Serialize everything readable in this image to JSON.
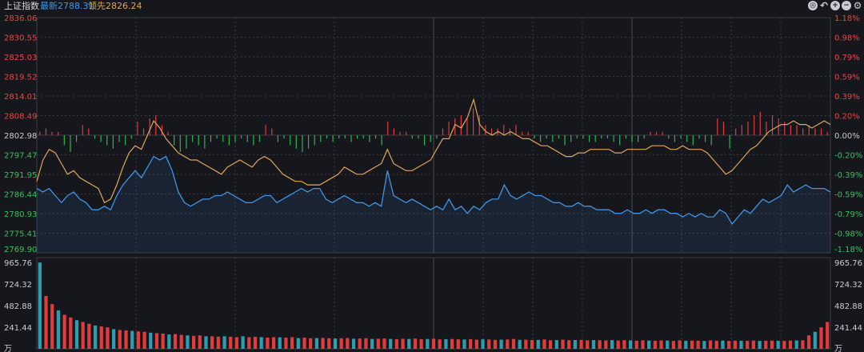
{
  "header": {
    "title": "上证指数",
    "latest": "最新2788.31",
    "lead": "领先2826.24"
  },
  "tools": [
    {
      "name": "target-icon",
      "glyph": "◎"
    },
    {
      "name": "undo-icon",
      "glyph": "↶"
    },
    {
      "name": "zoom-in-icon",
      "glyph": "+"
    },
    {
      "name": "zoom-out-icon",
      "glyph": "−"
    },
    {
      "name": "settings-icon",
      "glyph": "⚙"
    }
  ],
  "colors": {
    "up": "#e23b3b",
    "down": "#2eb44c",
    "price_line": "#3f95e8",
    "lead_line": "#e0a45a",
    "volume_teal": "#2a9fb0",
    "grid": "#3a3c44"
  },
  "chart_data": [
    {
      "type": "line",
      "y_left_ticks": [
        "2836.06",
        "2830.55",
        "2825.03",
        "2819.52",
        "2814.01",
        "2808.49",
        "2802.98",
        "2797.47",
        "2791.95",
        "2786.44",
        "2780.93",
        "2775.41",
        "2769.90"
      ],
      "y_right_ticks": [
        "1.18%",
        "0.98%",
        "0.79%",
        "0.59%",
        "0.39%",
        "0.20%",
        "0.00%",
        "-0.20%",
        "-0.39%",
        "-0.59%",
        "-0.79%",
        "-0.98%",
        "-1.18%"
      ],
      "ylim": [
        2769.9,
        2836.06
      ],
      "base": 2802.98,
      "series": [
        {
          "key": "price",
          "values": [
            2788,
            2787,
            2788,
            2786,
            2784,
            2786,
            2787,
            2785,
            2784,
            2782,
            2782,
            2783,
            2782,
            2786,
            2789,
            2791,
            2793,
            2791,
            2794,
            2797,
            2796,
            2797,
            2793,
            2787,
            2784,
            2783,
            2784,
            2785,
            2785,
            2786,
            2786,
            2787,
            2786,
            2785,
            2784,
            2784,
            2785,
            2786,
            2786,
            2784,
            2785,
            2786,
            2787,
            2788,
            2787,
            2788,
            2788,
            2785,
            2784,
            2785,
            2786,
            2785,
            2784,
            2784,
            2783,
            2784,
            2783,
            2793,
            2786,
            2785,
            2784,
            2785,
            2784,
            2783,
            2782,
            2783,
            2782,
            2785,
            2782,
            2783,
            2781,
            2783,
            2782,
            2784,
            2785,
            2785,
            2789,
            2786,
            2785,
            2786,
            2787,
            2786,
            2786,
            2785,
            2784,
            2784,
            2783,
            2783,
            2784,
            2783,
            2783,
            2782,
            2782,
            2782,
            2781,
            2781,
            2782,
            2781,
            2781,
            2782,
            2781,
            2782,
            2782,
            2781,
            2781,
            2780,
            2781,
            2780,
            2781,
            2780,
            2780,
            2782,
            2781,
            2778,
            2780,
            2782,
            2781,
            2783,
            2785,
            2784,
            2785,
            2786,
            2789,
            2787,
            2788,
            2789,
            2788,
            2788,
            2788,
            2787
          ]
        },
        {
          "key": "lead",
          "values": [
            2790,
            2796,
            2799,
            2798,
            2795,
            2792,
            2793,
            2791,
            2790,
            2789,
            2788,
            2784,
            2785,
            2789,
            2794,
            2798,
            2800,
            2799,
            2803,
            2807,
            2805,
            2802,
            2800,
            2798,
            2797,
            2796,
            2796,
            2795,
            2794,
            2793,
            2792,
            2794,
            2795,
            2796,
            2795,
            2794,
            2796,
            2797,
            2796,
            2794,
            2792,
            2791,
            2790,
            2790,
            2789,
            2789,
            2789,
            2790,
            2791,
            2792,
            2794,
            2793,
            2792,
            2792,
            2793,
            2794,
            2795,
            2799,
            2795,
            2794,
            2793,
            2793,
            2794,
            2795,
            2796,
            2799,
            2802,
            2802,
            2806,
            2805,
            2808,
            2813,
            2806,
            2804,
            2803,
            2804,
            2803,
            2804,
            2803,
            2802,
            2802,
            2801,
            2800,
            2800,
            2799,
            2798,
            2797,
            2797,
            2798,
            2798,
            2799,
            2799,
            2799,
            2799,
            2798,
            2798,
            2799,
            2799,
            2799,
            2799,
            2800,
            2800,
            2800,
            2799,
            2799,
            2800,
            2799,
            2799,
            2799,
            2798,
            2796,
            2794,
            2792,
            2793,
            2795,
            2797,
            2799,
            2800,
            2802,
            2804,
            2805,
            2806,
            2806,
            2807,
            2806,
            2806,
            2805,
            2806,
            2807,
            2806
          ]
        }
      ],
      "bars": [
        1,
        2,
        1,
        1,
        -3,
        -5,
        -2,
        3,
        2,
        -1,
        -2,
        -3,
        -4,
        -2,
        -3,
        -1,
        4,
        2,
        5,
        6,
        3,
        1,
        -3,
        -5,
        -4,
        -2,
        -3,
        -4,
        -2,
        -1,
        -2,
        -3,
        -2,
        -1,
        -2,
        -3,
        -2,
        3,
        2,
        -2,
        -1,
        -3,
        -4,
        -5,
        -4,
        -3,
        -2,
        -1,
        -2,
        -1,
        -1,
        -2,
        -1,
        -1,
        -2,
        -1,
        -3,
        4,
        2,
        1,
        1,
        -1,
        -1,
        -3,
        -2,
        -1,
        2,
        4,
        5,
        6,
        5,
        8,
        6,
        3,
        2,
        2,
        3,
        2,
        3,
        1,
        1,
        -1,
        -2,
        -1,
        -2,
        -1,
        -3,
        -2,
        -1,
        -1,
        -2,
        -2,
        -1,
        -1,
        -2,
        -3,
        -1,
        -2,
        -2,
        -1,
        1,
        1,
        1,
        -1,
        -2,
        -1,
        -2,
        -3,
        -1,
        -2,
        -3,
        5,
        4,
        -4,
        2,
        3,
        4,
        6,
        7,
        4,
        6,
        5,
        4,
        3,
        3,
        2,
        3,
        2,
        2,
        1
      ]
    },
    {
      "type": "bar",
      "y_left_ticks": [
        "965.76",
        "724.32",
        "482.88",
        "241.44",
        "万"
      ],
      "y_right_ticks": [
        "965.76",
        "724.32",
        "482.88",
        "241.44",
        "万"
      ],
      "ylim": [
        0,
        965.76
      ],
      "values": [
        965,
        590,
        500,
        430,
        380,
        350,
        320,
        300,
        280,
        260,
        250,
        240,
        220,
        210,
        205,
        200,
        195,
        190,
        180,
        175,
        170,
        160,
        165,
        155,
        150,
        145,
        150,
        140,
        140,
        135,
        140,
        135,
        130,
        140,
        130,
        135,
        130,
        125,
        130,
        128,
        125,
        130,
        120,
        125,
        118,
        120,
        122,
        118,
        115,
        117,
        120,
        112,
        115,
        118,
        110,
        112,
        115,
        110,
        108,
        112,
        110,
        115,
        108,
        110,
        112,
        105,
        108,
        110,
        106,
        104,
        108,
        102,
        106,
        104,
        100,
        102,
        104,
        110,
        100,
        102,
        98,
        100,
        104,
        96,
        98,
        102,
        96,
        98,
        100,
        95,
        98,
        96,
        94,
        97,
        92,
        96,
        94,
        90,
        95,
        92,
        90,
        94,
        92,
        88,
        95,
        90,
        92,
        90,
        88,
        94,
        90,
        92,
        88,
        91,
        90,
        89,
        92,
        88,
        90,
        91,
        89,
        88,
        92,
        93,
        95,
        150,
        190,
        240,
        300
      ]
    }
  ]
}
